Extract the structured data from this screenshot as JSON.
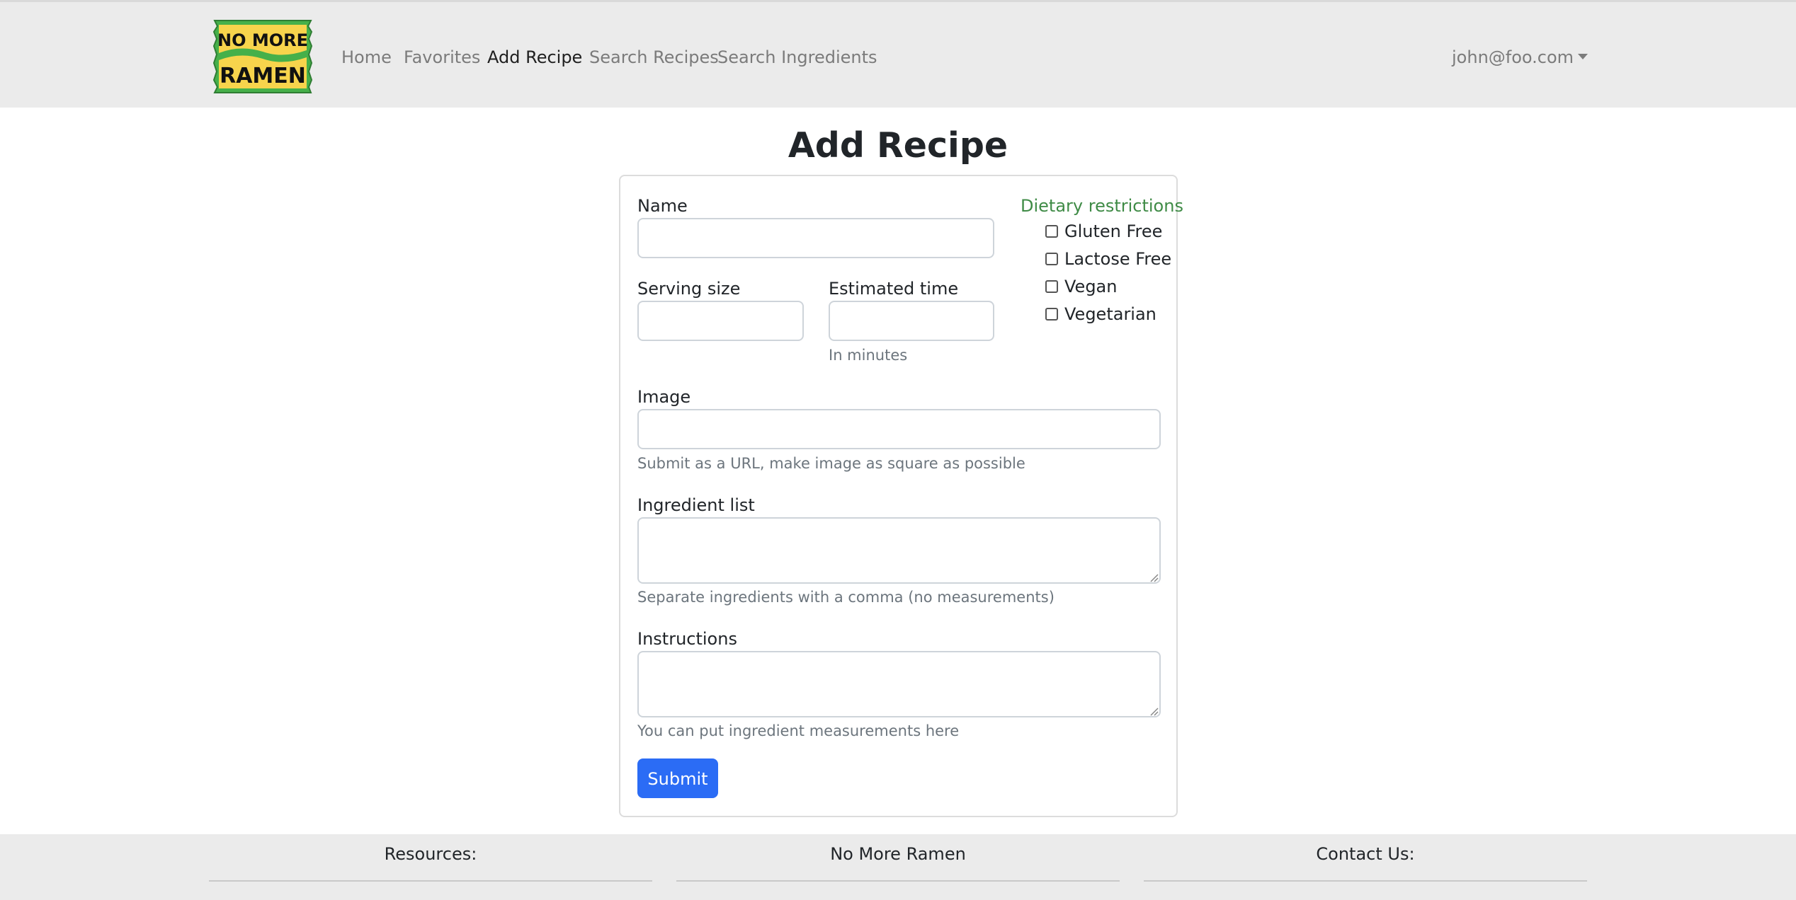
{
  "logo": {
    "line1": "NO MORE",
    "line2": "RAMEN",
    "bag_color": "#46b04a",
    "label_color": "#f7d44c"
  },
  "nav": {
    "items": [
      {
        "label": "Home",
        "active": false
      },
      {
        "label": "Favorites",
        "active": false
      },
      {
        "label": "Add Recipe",
        "active": true
      },
      {
        "label": "Search Recipes",
        "active": false
      },
      {
        "label": "Search Ingredients",
        "active": false
      }
    ],
    "user": "john@foo.com"
  },
  "page": {
    "title": "Add Recipe"
  },
  "form": {
    "name": {
      "label": "Name",
      "value": ""
    },
    "serving_size": {
      "label": "Serving size",
      "value": ""
    },
    "estimated_time": {
      "label": "Estimated time",
      "value": "",
      "help": "In minutes"
    },
    "image": {
      "label": "Image",
      "value": "",
      "help": "Submit as a URL, make image as square as possible"
    },
    "ingredients": {
      "label": "Ingredient list",
      "value": "",
      "help": "Separate ingredients with a comma (no measurements)"
    },
    "instructions": {
      "label": "Instructions",
      "value": "",
      "help": "You can put ingredient measurements here"
    },
    "dietary": {
      "title": "Dietary restrictions",
      "options": [
        {
          "label": "Gluten Free",
          "checked": false
        },
        {
          "label": "Lactose Free",
          "checked": false
        },
        {
          "label": "Vegan",
          "checked": false
        },
        {
          "label": "Vegetarian",
          "checked": false
        }
      ]
    },
    "submit_label": "Submit"
  },
  "footer": {
    "columns": [
      "Resources:",
      "No More Ramen",
      "Contact Us:"
    ]
  },
  "colors": {
    "accent": "#2b6cf5",
    "dietary_title": "#3f8b46",
    "navbar_bg": "#ebebeb"
  }
}
